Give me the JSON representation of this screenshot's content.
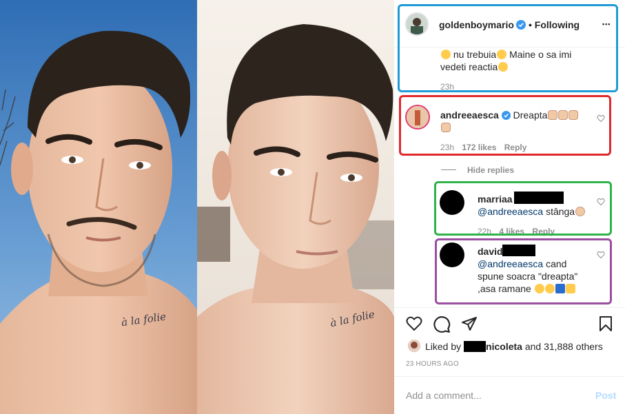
{
  "post": {
    "username": "goldenboymario",
    "following_label": "• Following",
    "more_label": "•••",
    "caption_line1": "nu trebuia",
    "caption_line1b": "Maine o sa imi",
    "caption_line2": "vedeti reactia",
    "caption_time": "23h"
  },
  "comments": [
    {
      "username": "andreeaesca",
      "text": "Dreapta",
      "time": "23h",
      "likes": "172 likes",
      "reply": "Reply"
    },
    {
      "username": "marriaa",
      "mention": "@andreeaesca",
      "text": "stânga",
      "time": "22h",
      "likes": "4 likes",
      "reply": "Reply"
    },
    {
      "username": "david",
      "mention": "@andreeaesca",
      "text1": "cand",
      "text2": "spune soacra \"dreapta\"",
      "text3": ",asa ramane"
    }
  ],
  "hide_replies": "Hide replies",
  "liked_by": {
    "prefix": "Liked by",
    "name": "nicoleta",
    "suffix": "and 31,888 others"
  },
  "timestamp": "23 HOURS AGO",
  "add_comment": {
    "placeholder": "Add a comment...",
    "post_label": "Post"
  },
  "photo_text": {
    "tattoo_left": "à la folie",
    "tattoo_right": "à la folie"
  },
  "colors": {
    "blue_frame": "#1e9ad6",
    "red_frame": "#e0282b",
    "green_frame": "#2eb24a",
    "purple_frame": "#9a4ea0",
    "verified": "#3897f0",
    "post_disabled": "#b3dbff"
  }
}
